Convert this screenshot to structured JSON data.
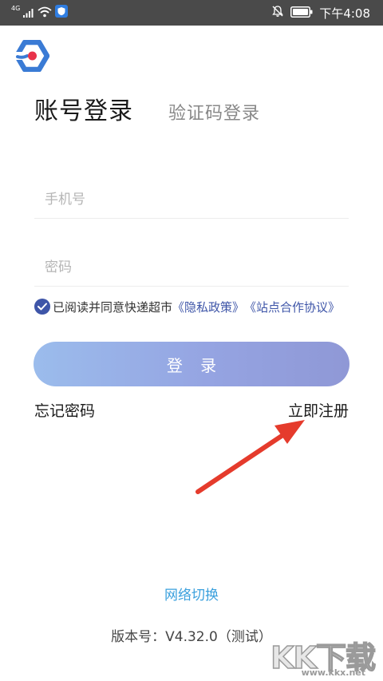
{
  "status_bar": {
    "network_label": "4G",
    "time": "下午4:08"
  },
  "login": {
    "tab_account": "账号登录",
    "tab_sms": "验证码登录",
    "phone_placeholder": "手机号",
    "password_placeholder": "密码",
    "agreement": {
      "checked": true,
      "prefix": "已阅读并同意快递超市",
      "privacy_link": "《隐私政策》",
      "cooperation_link": "《站点合作协议》"
    },
    "login_button": "登 录",
    "forgot_password": "忘记密码",
    "register": "立即注册"
  },
  "footer": {
    "network_switch": "网络切换",
    "version": "版本号：V4.32.0（测试）"
  },
  "watermark": {
    "title": "KK下载",
    "url": "www.kkx.net"
  },
  "colors": {
    "status_bar": "#4a4a4a",
    "accent": "#3e55a8",
    "link_blue": "#3aa0dd",
    "arrow_red": "#e53b2c",
    "logo_blue": "#3a7bd5",
    "logo_red": "#e8324a"
  }
}
